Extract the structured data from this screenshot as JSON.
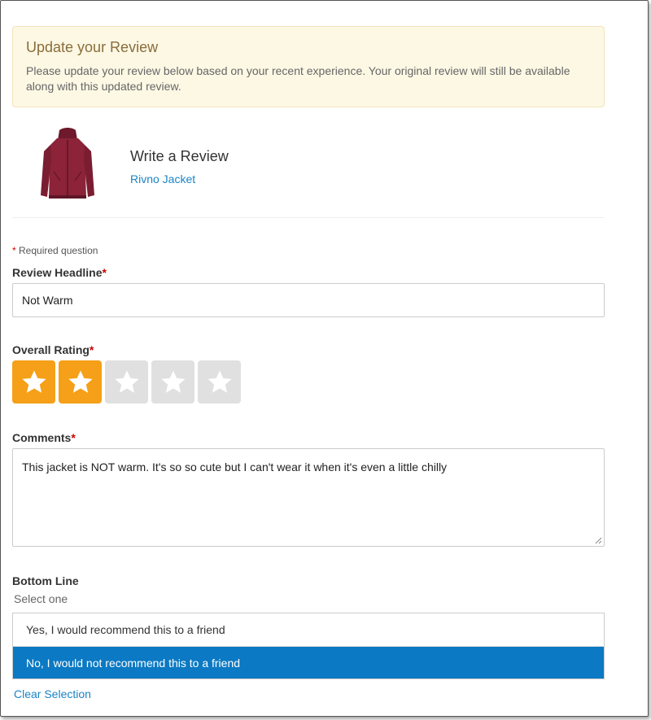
{
  "alert": {
    "title": "Update your Review",
    "message": "Please update your review below based on your recent experience. Your original review will still be available along with this updated review."
  },
  "product": {
    "heading": "Write a Review",
    "name": "Rivno Jacket",
    "image_icon": "jacket-thumbnail"
  },
  "required_note": "Required question",
  "required_marker": "*",
  "headline": {
    "label": "Review Headline",
    "value": "Not Warm"
  },
  "rating": {
    "label": "Overall Rating",
    "value": 2,
    "max": 5,
    "active_color": "#f5a018",
    "inactive_color": "#e0e0e0"
  },
  "comments": {
    "label": "Comments",
    "value": "This jacket is NOT warm. It's so so cute but I can't wear it when it's even a little chilly"
  },
  "bottom_line": {
    "label": "Bottom Line",
    "hint": "Select one",
    "options": [
      "Yes, I would recommend this to a friend",
      "No, I would not recommend this to a friend"
    ],
    "selected_index": 1,
    "clear_label": "Clear Selection"
  },
  "colors": {
    "link": "#1a85c4",
    "selected": "#0b79c3",
    "alert_bg": "#fcf8e4",
    "alert_title": "#8a6d3b"
  }
}
